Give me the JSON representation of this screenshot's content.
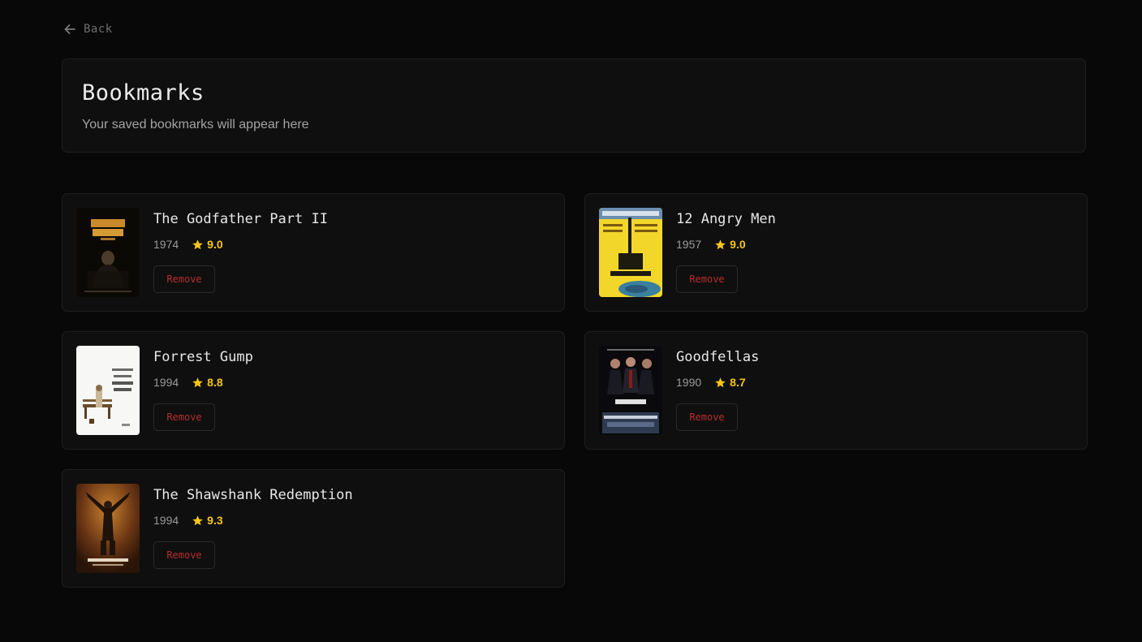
{
  "back": {
    "label": "Back",
    "icon": "arrow-left-icon"
  },
  "header": {
    "title": "Bookmarks",
    "subtitle": "Your saved bookmarks will appear here"
  },
  "colors": {
    "background": "#080808",
    "card": "#0f0f0f",
    "border": "#1e1e1e",
    "rating": "#f5c518",
    "remove": "#b72d2d"
  },
  "bookmarks": [
    {
      "title": "The Godfather Part II",
      "year": "1974",
      "rating": "9.0",
      "remove_label": "Remove"
    },
    {
      "title": "12 Angry Men",
      "year": "1957",
      "rating": "9.0",
      "remove_label": "Remove"
    },
    {
      "title": "Forrest Gump",
      "year": "1994",
      "rating": "8.8",
      "remove_label": "Remove"
    },
    {
      "title": "Goodfellas",
      "year": "1990",
      "rating": "8.7",
      "remove_label": "Remove"
    },
    {
      "title": "The Shawshank Redemption",
      "year": "1994",
      "rating": "9.3",
      "remove_label": "Remove"
    }
  ]
}
